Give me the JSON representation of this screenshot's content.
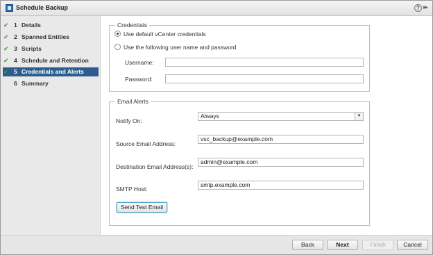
{
  "window": {
    "title": "Schedule Backup",
    "help_glyph": "?",
    "expand_glyph": "▸▸"
  },
  "sidebar": {
    "steps": [
      {
        "num": "1",
        "label": "Details",
        "completed": true
      },
      {
        "num": "2",
        "label": "Spanned Entities",
        "completed": true
      },
      {
        "num": "3",
        "label": "Scripts",
        "completed": true
      },
      {
        "num": "4",
        "label": "Schedule and Retention",
        "completed": true
      },
      {
        "num": "5",
        "label": "Credentials and Alerts",
        "completed": true,
        "active": true
      },
      {
        "num": "6",
        "label": "Summary",
        "completed": false
      }
    ],
    "check_glyph": "✔"
  },
  "credentials": {
    "legend": "Credentials",
    "option_default": "Use default vCenter credentials",
    "option_custom": "Use the following user name and password",
    "selected": "default",
    "username_label": "Username:",
    "username_value": "",
    "password_label": "Password:",
    "password_value": ""
  },
  "email_alerts": {
    "legend": "Email Alerts",
    "notify_label": "Notify On:",
    "notify_value": "Always",
    "source_label": "Source Email Address:",
    "source_value": "vsc_backup@example.com",
    "destination_label": "Destination Email Address(s):",
    "destination_value": "admin@example.com",
    "smtp_label": "SMTP Host:",
    "smtp_value": "smtp.example.com",
    "test_button": "Send Test Email"
  },
  "footer": {
    "back": "Back",
    "next": "Next",
    "finish": "Finish",
    "cancel": "Cancel"
  },
  "colors": {
    "active_step": "#2c5d8f",
    "check": "#3f9b32",
    "focus_outline": "#4ea3c9"
  }
}
